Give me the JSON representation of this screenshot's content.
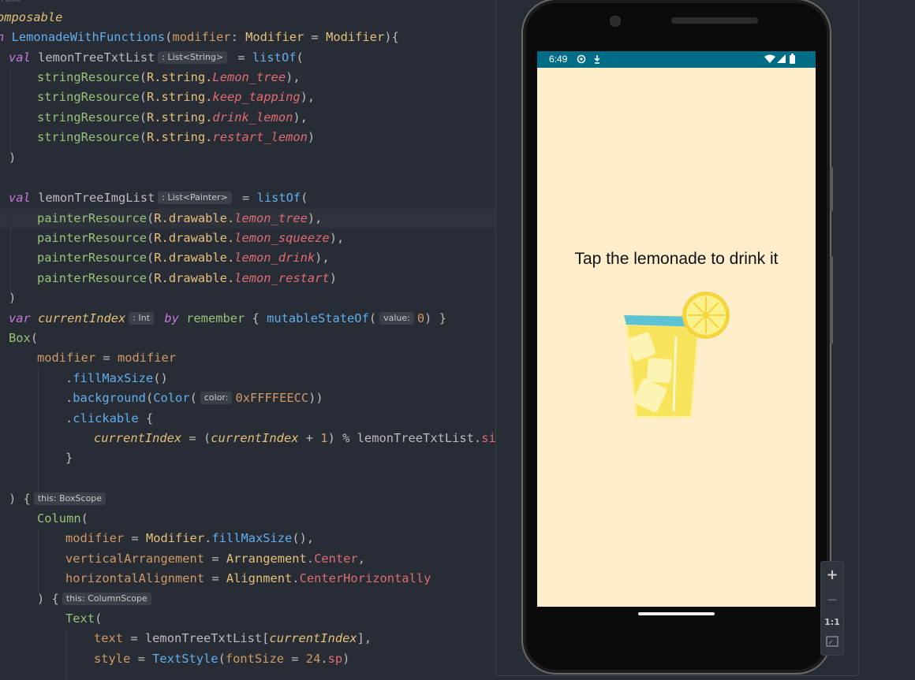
{
  "editor": {
    "top_fragment": "ramo",
    "annotation": "omposable",
    "func_fun_fragment": "n",
    "func_name": "LemonadeWithFunctions",
    "func_param": "modifier",
    "func_param_type": "Modifier",
    "func_param_default": "Modifier",
    "kw_val": "val",
    "kw_var": "var",
    "kw_by": "by",
    "txt_list_name": "lemonTreeTxtList",
    "txt_list_hint": ": List<String>",
    "list_of": "listOf",
    "string_resource": "stringResource",
    "r_string": "R.string.",
    "string_res": [
      "Lemon_tree",
      "keep_tapping",
      "drink_lemon",
      "restart_lemon"
    ],
    "img_list_name": "lemonTreeImgList",
    "img_list_hint": ": List<Painter>",
    "painter_resource": "painterResource",
    "r_drawable": "R.drawable.",
    "drawable_res": [
      "lemon_tree",
      "lemon_squeeze",
      "lemon_drink",
      "lemon_restart"
    ],
    "current_index": "currentIndex",
    "int_hint": ": Int",
    "remember": "remember",
    "mutable_state_of": "mutableStateOf",
    "value_hint": "value:",
    "zero": "0",
    "box": "Box",
    "modifier_word": "modifier",
    "fill_max_size": "fillMaxSize",
    "background": "background",
    "color_fn": "Color",
    "color_hint": "color:",
    "color_value": "0xFFFFEECC",
    "clickable": "clickable",
    "one": "1",
    "size_fragment": "size",
    "box_scope_hint": "this: BoxScope",
    "column": "Column",
    "modifier_type": "Modifier",
    "vertical_arrangement": "verticalArrangement",
    "arrangement": "Arrangement",
    "center": "Center",
    "horizontal_alignment": "horizontalAlignment",
    "alignment": "Alignment",
    "center_horizontally": "CenterHorizontally",
    "column_scope_hint": "this: ColumnScope",
    "text_fn": "Text",
    "text_param": "text",
    "style_param": "style",
    "text_style": "TextStyle",
    "font_size": "fontSize",
    "font_size_value": "24",
    "sp": "sp"
  },
  "device": {
    "status_time": "6:49",
    "screen_background": "#FFEECC",
    "status_bar_color": "#016C86",
    "message": "Tap the lemonade to drink it",
    "image_icon": "lemonade-glass-icon"
  },
  "zoom_toolbar": {
    "zoom_in": "+",
    "zoom_out": "−",
    "actual_size": "1:1",
    "fit_icon": "fit-screen-icon"
  }
}
